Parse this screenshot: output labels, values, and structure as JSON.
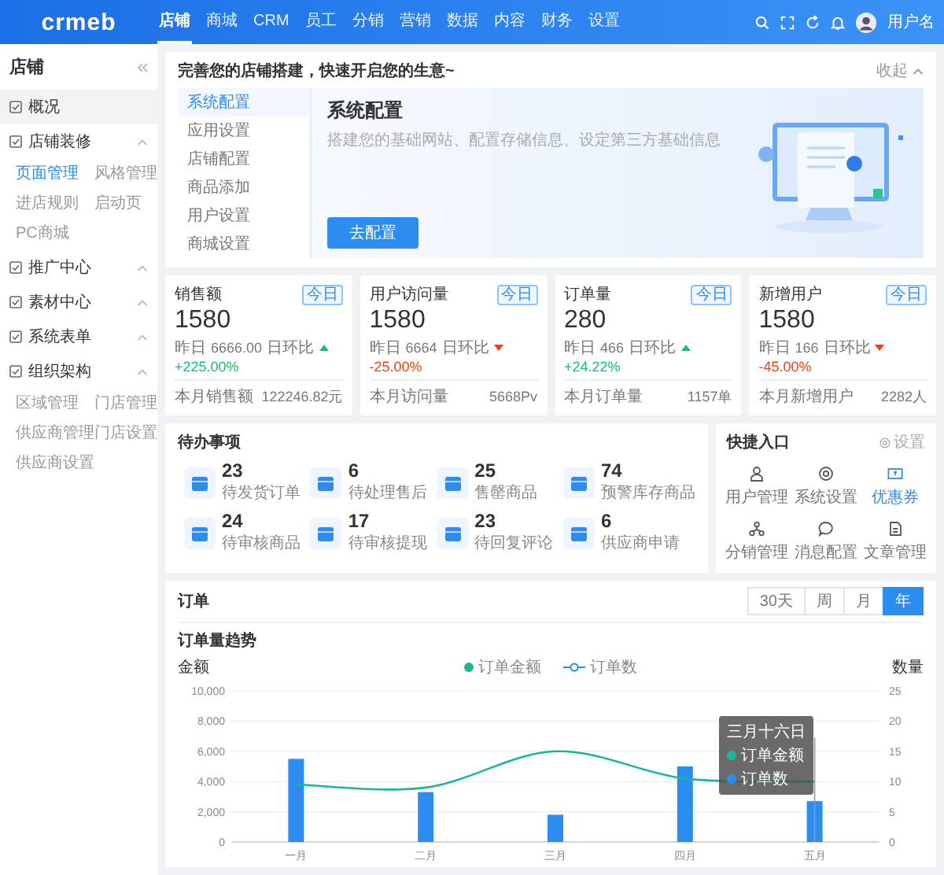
{
  "header": {
    "logo": "crmeb",
    "nav": [
      {
        "label": "店铺",
        "selected": true
      },
      {
        "label": "商城",
        "selected": false
      },
      {
        "label": "CRM",
        "selected": false
      },
      {
        "label": "员工",
        "selected": false
      },
      {
        "label": "分销",
        "selected": false
      },
      {
        "label": "营销",
        "selected": false
      },
      {
        "label": "数据",
        "selected": false
      },
      {
        "label": "内容",
        "selected": false
      },
      {
        "label": "财务",
        "selected": false
      },
      {
        "label": "设置",
        "selected": false
      }
    ],
    "username": "用户名"
  },
  "sidebar": {
    "title": "店铺",
    "items": [
      {
        "label": "概况",
        "kind": "link",
        "selected": true
      },
      {
        "label": "店铺装修",
        "kind": "group",
        "selected": false,
        "children": [
          {
            "label": "页面管理",
            "selected": true
          },
          {
            "label": "风格管理",
            "selected": false
          },
          {
            "label": "进店规则",
            "selected": false
          },
          {
            "label": "启动页",
            "selected": false
          },
          {
            "label": "PC商城",
            "selected": false
          }
        ]
      },
      {
        "label": "推广中心",
        "kind": "group",
        "selected": false
      },
      {
        "label": "素材中心",
        "kind": "group",
        "selected": false
      },
      {
        "label": "系统表单",
        "kind": "group",
        "selected": false
      },
      {
        "label": "组织架构",
        "kind": "group",
        "selected": false,
        "children": [
          {
            "label": "区域管理",
            "selected": false
          },
          {
            "label": "门店管理",
            "selected": false
          },
          {
            "label": "供应商管理",
            "selected": false
          },
          {
            "label": "门店设置",
            "selected": false
          },
          {
            "label": "供应商设置",
            "selected": false
          }
        ]
      }
    ]
  },
  "guide": {
    "title": "完善您的店铺搭建，快速开启您的生意~",
    "collapse": "收起",
    "steps": [
      {
        "label": "系统配置",
        "selected": true
      },
      {
        "label": "应用设置",
        "selected": false
      },
      {
        "label": "店铺配置",
        "selected": false
      },
      {
        "label": "商品添加",
        "selected": false
      },
      {
        "label": "用户设置",
        "selected": false
      },
      {
        "label": "商城设置",
        "selected": false
      }
    ],
    "panel_title": "系统配置",
    "panel_text": "搭建您的基础网站、配置存储信息、设定第三方基础信息",
    "button": "去配置"
  },
  "stats": [
    {
      "title": "销售额",
      "badge": "今日",
      "value": "1580",
      "yesterday_label": "昨日",
      "yesterday": "6666.00",
      "compare_label": "日环比",
      "rising": true,
      "change": "+225.00%",
      "month_label": "本月销售额",
      "month_value": "122246.82元"
    },
    {
      "title": "用户访问量",
      "badge": "今日",
      "value": "1580",
      "yesterday_label": "昨日",
      "yesterday": "6664",
      "compare_label": "日环比",
      "rising": false,
      "change": "-25.00%",
      "month_label": "本月访问量",
      "month_value": "5668Pv"
    },
    {
      "title": "订单量",
      "badge": "今日",
      "value": "280",
      "yesterday_label": "昨日",
      "yesterday": "466",
      "compare_label": "日环比",
      "rising": true,
      "change": "+24.22%",
      "month_label": "本月订单量",
      "month_value": "1157单"
    },
    {
      "title": "新增用户",
      "badge": "今日",
      "value": "1580",
      "yesterday_label": "昨日",
      "yesterday": "166",
      "compare_label": "日环比",
      "rising": false,
      "change": "-45.00%",
      "month_label": "本月新增用户",
      "month_value": "2282人"
    }
  ],
  "todo": {
    "title": "待办事项",
    "items": [
      {
        "count": "23",
        "label": "待发货订单"
      },
      {
        "count": "6",
        "label": "待处理售后"
      },
      {
        "count": "25",
        "label": "售罄商品"
      },
      {
        "count": "74",
        "label": "预警库存商品"
      },
      {
        "count": "24",
        "label": "待审核商品"
      },
      {
        "count": "17",
        "label": "待审核提现"
      },
      {
        "count": "23",
        "label": "待回复评论"
      },
      {
        "count": "6",
        "label": "供应商申请"
      }
    ]
  },
  "quick": {
    "title": "快捷入口",
    "settings": "设置",
    "items": [
      {
        "label": "用户管理",
        "selected": false
      },
      {
        "label": "系统设置",
        "selected": false
      },
      {
        "label": "优惠券",
        "selected": true
      },
      {
        "label": "分销管理",
        "selected": false
      },
      {
        "label": "消息配置",
        "selected": false
      },
      {
        "label": "文章管理",
        "selected": false
      }
    ]
  },
  "orders": {
    "title": "订单",
    "ranges": [
      {
        "label": "30天",
        "selected": false
      },
      {
        "label": "周",
        "selected": false
      },
      {
        "label": "月",
        "selected": false
      },
      {
        "label": "年",
        "selected": true
      }
    ],
    "chart_data": {
      "type": "bar",
      "title": "订单量趋势",
      "ylabel": "金额",
      "y2label": "数量",
      "categories": [
        "一月",
        "二月",
        "三月",
        "四月",
        "五月"
      ],
      "grid": true,
      "legend": "top",
      "series": [
        {
          "name": "订单金额",
          "type": "line",
          "color": "#1bb59a",
          "values": [
            3800,
            3600,
            6000,
            4200,
            4000
          ]
        },
        {
          "name": "订单数",
          "type": "bar",
          "color": "#2d8cf0",
          "values": [
            5500,
            3300,
            1800,
            5000,
            2700
          ]
        }
      ],
      "ylim": [
        0,
        10000
      ],
      "yticks": [
        {
          "value": 0,
          "label": "0"
        },
        {
          "value": 2000,
          "label": "2,000"
        },
        {
          "value": 4000,
          "label": "4,000"
        },
        {
          "value": 6000,
          "label": "6,000"
        },
        {
          "value": 8000,
          "label": "8,000"
        },
        {
          "value": 10000,
          "label": "10,000"
        }
      ],
      "y2lim": [
        0,
        25
      ],
      "y2ticks": [
        0,
        5,
        10,
        15,
        20,
        25
      ]
    },
    "tooltip": {
      "title": "三月十六日",
      "items": [
        {
          "label": "订单金额",
          "color": "#1bb59a"
        },
        {
          "label": "订单数",
          "color": "#2d8cf0"
        }
      ]
    }
  }
}
